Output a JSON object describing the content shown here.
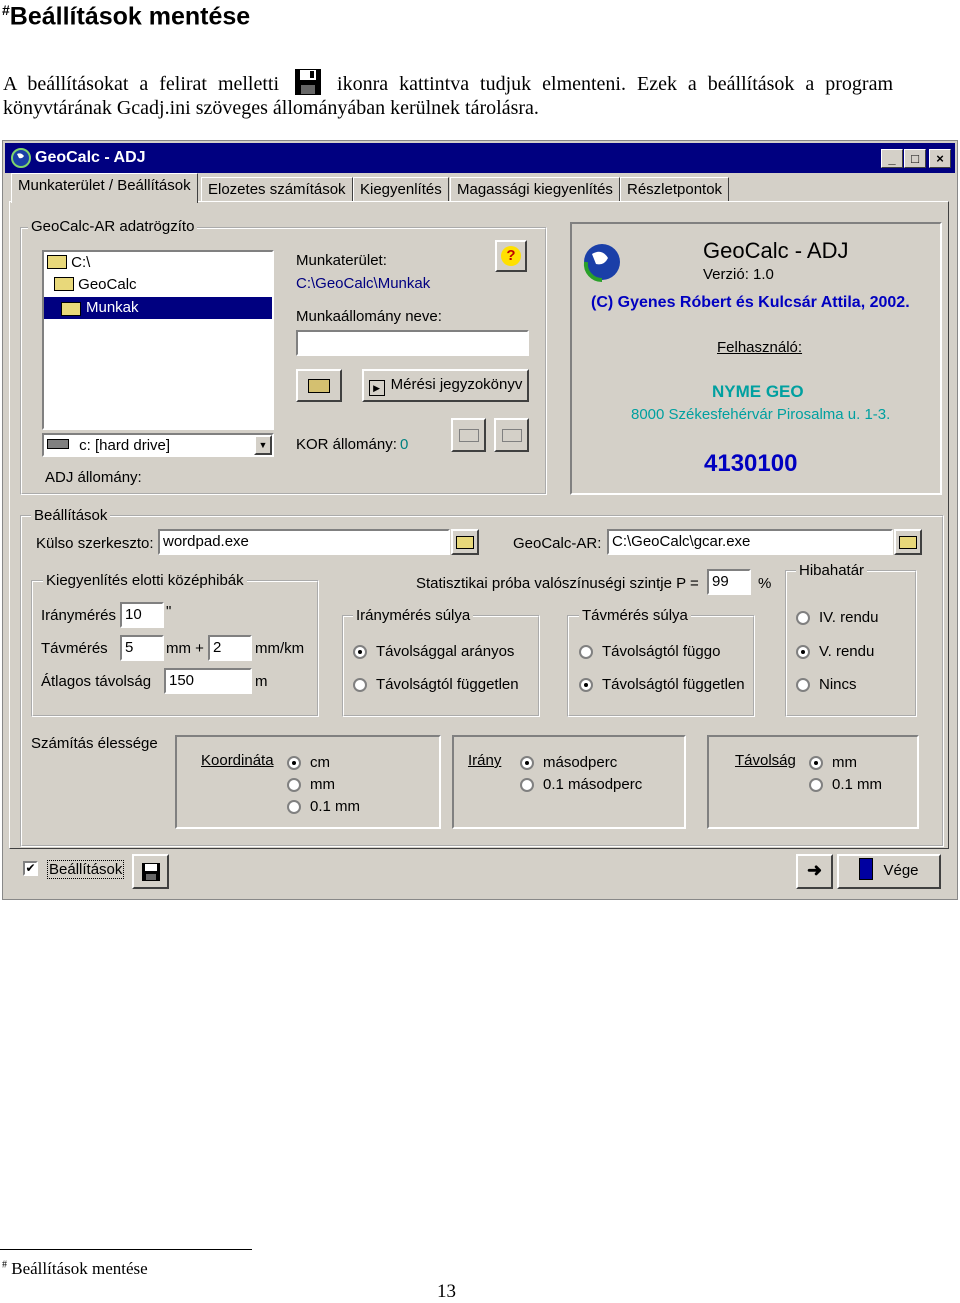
{
  "doc": {
    "title_mark": "#",
    "title": "Beállítások mentése",
    "para_part1": "A beállításokat a felirat melletti",
    "para_part2": "ikonra kattintva tudjuk elmenteni. Ezek a beállítások a program könyvtárának Gcadj.ini szöveges állományában kerülnek tárolásra.",
    "footnote_mark": "#",
    "footnote": "Beállítások mentése",
    "page_number": "13"
  },
  "window": {
    "title": "GeoCalc - ADJ",
    "controls": [
      "_",
      "□",
      "×"
    ],
    "tabs": [
      "Munkaterület / Beállítások",
      "Elozetes számítások",
      "Kiegyenlítés",
      "Magassági kiegyenlítés",
      "Részletpontok"
    ],
    "recorder": {
      "group_label": "GeoCalc-AR adatrögzíto",
      "tree": [
        "C:\\",
        "GeoCalc",
        "Munkak"
      ],
      "drive": "c: [hard drive]",
      "adj_label": "ADJ állomány:",
      "workspace_label": "Munkaterület:",
      "workspace_value": "C:\\GeoCalc\\Munkak",
      "station_label": "Munkaállomány neve:",
      "station_value": "",
      "protocol_button": "Mérési jegyzokönyv",
      "kor_label": "KOR állomány:",
      "kor_value": "0"
    },
    "about": {
      "app_name": "GeoCalc - ADJ",
      "version": "Verzió: 1.0",
      "copyright": "(C) Gyenes Róbert és Kulcsár Attila, 2002.",
      "user_label": "Felhasználó:",
      "org": "NYME GEO",
      "address": "8000 Székesfehérvár Pirosalma u. 1-3.",
      "serial": "4130100"
    },
    "settings": {
      "group_label": "Beállítások",
      "editor_label": "Külso szerkeszto:",
      "editor_value": "wordpad.exe",
      "gcar_label": "GeoCalc-AR:",
      "gcar_value": "C:\\GeoCalc\\gcar.exe",
      "stat_label": "Statisztikai próba valószínuségi szintje  P =",
      "stat_value": "99",
      "stat_unit": "%",
      "errors_group": "Kiegyenlítés elotti középhibák",
      "dir_label": "Iránymérés",
      "dir_value": "10",
      "dir_unit": "\"",
      "dist_label": "Távmérés",
      "dist_value": "5",
      "dist_unit1": "mm +",
      "dist_value2": "2",
      "dist_unit2": "mm/km",
      "avg_label": "Átlagos távolság",
      "avg_value": "150",
      "avg_unit": "m",
      "dir_weight_group": "Iránymérés súlya",
      "dir_weight_options": [
        "Távolsággal arányos",
        "Távolságtól független"
      ],
      "dir_weight_selected": 0,
      "dist_weight_group": "Távmérés súlya",
      "dist_weight_options": [
        "Távolságtól függo",
        "Távolságtól független"
      ],
      "dist_weight_selected": 1,
      "limit_group": "Hibahatár",
      "limit_options": [
        "IV. rendu",
        "V. rendu",
        "Nincs"
      ],
      "limit_selected": 1,
      "precision_label": "Számítás élessége",
      "coord_label": "Koordináta",
      "coord_options": [
        "cm",
        "mm",
        "0.1 mm"
      ],
      "coord_selected": 0,
      "dir_prec_label": "Irány",
      "dir_prec_options": [
        "másodperc",
        "0.1 másodperc"
      ],
      "dir_prec_selected": 0,
      "dist_prec_label": "Távolság",
      "dist_prec_options": [
        "mm",
        "0.1 mm"
      ],
      "dist_prec_selected": 0
    },
    "bottom": {
      "checkbox_label": "Beállítások",
      "checkbox_checked": true,
      "end_button": "Vége"
    }
  }
}
